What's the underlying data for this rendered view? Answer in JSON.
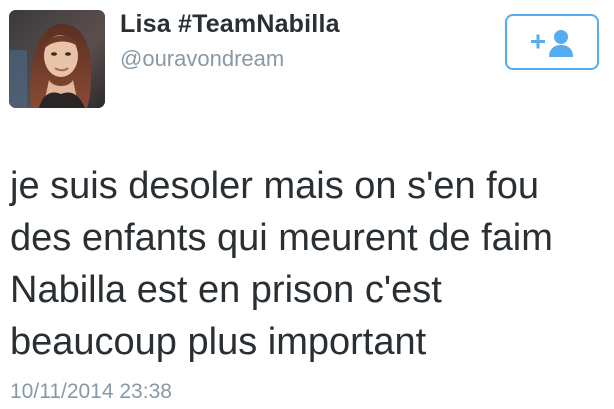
{
  "user": {
    "display_name": "Lisa #TeamNabilla",
    "handle": "@ouravondream",
    "avatar_icon": "profile-photo"
  },
  "follow_button": {
    "icon": "follow-person-plus-icon",
    "accent_color": "#55acee"
  },
  "tweet": {
    "text": "je suis desoler mais on s'en fou\ndes enfants qui meurent de faim\nNabilla est en prison c'est\nbeaucoup plus important",
    "timestamp": "10/11/2014 23:38"
  },
  "colors": {
    "text": "#292f33",
    "secondary_text": "#8899a6",
    "accent": "#55acee"
  }
}
